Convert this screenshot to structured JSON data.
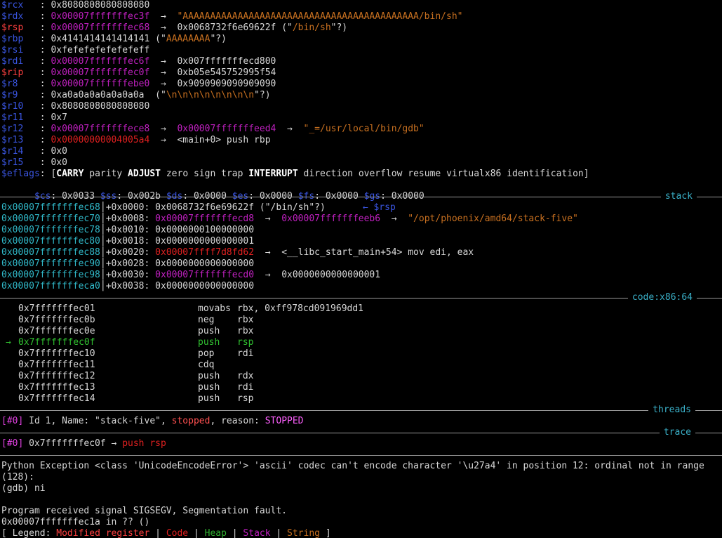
{
  "colors": {
    "register_name": "#3a55e0",
    "modified_register": "#ff4040",
    "stack_address": "#c020c0",
    "code_address": "#e02020",
    "string": "#c87020",
    "stack_slot_address": "#30b8c8",
    "current_instruction": "#30c030",
    "heap": "#30b030"
  },
  "registers": [
    {
      "name": "$rcx",
      "sep": "   : ",
      "value": "0x8080808080808080"
    },
    {
      "name": "$rdx",
      "sep": "   : ",
      "value": "0x00007fffffffec3f",
      "arrow": "  →  ",
      "deref": "\"AAAAAAAAAAAAAAAAAAAAAAAAAAAAAAAAAAAAAAAAAAA/bin/sh\""
    },
    {
      "name": "$rsp",
      "sep": "   : ",
      "value": "0x00007fffffffec68",
      "arrow": "  →  ",
      "deref": "0x0068732f6e69622f",
      "note_open": " (\"",
      "note": "/bin/sh",
      "note_close": "\"?)"
    },
    {
      "name": "$rbp",
      "sep": "   : ",
      "value": "0x4141414141414141",
      "note_open": " (\"",
      "note": "AAAAAAAA",
      "note_close": "\"?)"
    },
    {
      "name": "$rsi",
      "sep": "   : ",
      "value": "0xfefefefefefefeff"
    },
    {
      "name": "$rdi",
      "sep": "   : ",
      "value": "0x00007fffffffec6f",
      "arrow": "  →  ",
      "deref": "0x007fffffffecd800"
    },
    {
      "name": "$rip",
      "sep": "   : ",
      "value": "0x00007fffffffec0f",
      "arrow": "  →  ",
      "deref": "0xb05e545752995f54"
    },
    {
      "name": "$r8",
      "sep": "    : ",
      "value": "0x00007fffffffebe0",
      "arrow": "  →  ",
      "deref": "0x9090909090909090"
    },
    {
      "name": "$r9",
      "sep": "    : ",
      "value": "0xa0a0a0a0a0a0a0a",
      "note_open": "  (\"",
      "note": "\\n\\n\\n\\n\\n\\n\\n\\n",
      "note_close": "\"?)"
    },
    {
      "name": "$r10",
      "sep": "   : ",
      "value": "0x8080808080808080"
    },
    {
      "name": "$r11",
      "sep": "   : ",
      "value": "0x7"
    },
    {
      "name": "$r12",
      "sep": "   : ",
      "value": "0x00007fffffffece8",
      "arrow": "  →  ",
      "deref": "0x00007fffffffeed4",
      "arrow2": "  →  ",
      "deref2": "\"_=/usr/local/bin/gdb\""
    },
    {
      "name": "$r13",
      "sep": "   : ",
      "value": "0x00000000004005a4",
      "arrow": "  →  ",
      "deref": "<main+0> push rbp"
    },
    {
      "name": "$r14",
      "sep": "   : ",
      "value": "0x0"
    },
    {
      "name": "$r15",
      "sep": "   : ",
      "value": "0x0"
    }
  ],
  "eflags": {
    "name": "$eflags",
    "sep": ": ",
    "open": "[",
    "flags": [
      {
        "label": "CARRY",
        "set": true
      },
      {
        "label": "parity",
        "set": false
      },
      {
        "label": "ADJUST",
        "set": true
      },
      {
        "label": "zero",
        "set": false
      },
      {
        "label": "sign",
        "set": false
      },
      {
        "label": "trap",
        "set": false
      },
      {
        "label": "INTERRUPT",
        "set": true
      },
      {
        "label": "direction",
        "set": false
      },
      {
        "label": "overflow",
        "set": false
      },
      {
        "label": "resume",
        "set": false
      },
      {
        "label": "virtualx86",
        "set": false
      },
      {
        "label": "identification",
        "set": false
      }
    ],
    "close": "]"
  },
  "segments": [
    {
      "name": "$cs",
      "value": "0x0033"
    },
    {
      "name": "$ss",
      "value": "0x002b"
    },
    {
      "name": "$ds",
      "value": "0x0000"
    },
    {
      "name": "$es",
      "value": "0x0000"
    },
    {
      "name": "$fs",
      "value": "0x0000"
    },
    {
      "name": "$gs",
      "value": "0x0000"
    }
  ],
  "sections": {
    "stack": "stack",
    "code": "code:x86:64",
    "threads": "threads",
    "trace": "trace"
  },
  "stack": [
    {
      "addr": "0x00007fffffffec68",
      "off": "+0x0000: ",
      "value": "0x0068732f6e69622f",
      "vkind": "plain",
      "note": " (\"/bin/sh\"?)",
      "tag": "← $rsp"
    },
    {
      "addr": "0x00007fffffffec70",
      "off": "+0x0008: ",
      "value": "0x00007fffffffecd8",
      "vkind": "stack",
      "arrow": "  →  ",
      "deref": "0x00007fffffffeeb6",
      "dkind": "stack",
      "arrow2": "  →  ",
      "deref2": "\"/opt/phoenix/amd64/stack-five\""
    },
    {
      "addr": "0x00007fffffffec78",
      "off": "+0x0010: ",
      "value": "0x0000000100000000",
      "vkind": "plain"
    },
    {
      "addr": "0x00007fffffffec80",
      "off": "+0x0018: ",
      "value": "0x0000000000000001",
      "vkind": "plain"
    },
    {
      "addr": "0x00007fffffffec88",
      "off": "+0x0020: ",
      "value": "0x00007ffff7d8fd62",
      "vkind": "code",
      "arrow": "  →  ",
      "deref": "<__libc_start_main+54> mov edi, eax",
      "dkind": "plain"
    },
    {
      "addr": "0x00007fffffffec90",
      "off": "+0x0028: ",
      "value": "0x0000000000000000",
      "vkind": "plain"
    },
    {
      "addr": "0x00007fffffffec98",
      "off": "+0x0030: ",
      "value": "0x00007fffffffecd0",
      "vkind": "stack",
      "arrow": "  →  ",
      "deref": "0x0000000000000001",
      "dkind": "plain"
    },
    {
      "addr": "0x00007fffffffeca0",
      "off": "+0x0038: ",
      "value": "0x0000000000000000",
      "vkind": "plain"
    }
  ],
  "code": [
    {
      "addr": "0x7fffffffec01",
      "mnem": "movabs",
      "ops": "rbx, 0xff978cd091969dd1",
      "current": false
    },
    {
      "addr": "0x7fffffffec0b",
      "mnem": "neg",
      "ops": "rbx",
      "current": false
    },
    {
      "addr": "0x7fffffffec0e",
      "mnem": "push",
      "ops": "rbx",
      "current": false
    },
    {
      "addr": "0x7fffffffec0f",
      "mnem": "push",
      "ops": "rsp",
      "current": true,
      "marker": "→"
    },
    {
      "addr": "0x7fffffffec10",
      "mnem": "pop",
      "ops": "rdi",
      "current": false
    },
    {
      "addr": "0x7fffffffec11",
      "mnem": "cdq",
      "ops": "",
      "current": false
    },
    {
      "addr": "0x7fffffffec12",
      "mnem": "push",
      "ops": "rdx",
      "current": false
    },
    {
      "addr": "0x7fffffffec13",
      "mnem": "push",
      "ops": "rdi",
      "current": false
    },
    {
      "addr": "0x7fffffffec14",
      "mnem": "push",
      "ops": "rsp",
      "current": false
    }
  ],
  "threads": {
    "id_tag": "[#0]",
    "text1": " Id 1, Name: \"stack-five\", ",
    "state": "stopped",
    "text2": ", reason: ",
    "reason": "STOPPED"
  },
  "trace": {
    "id_tag": "[#0]",
    "addr": " 0x7fffffffec0f",
    "arrow": " → ",
    "instr": "push rsp"
  },
  "console": [
    "Python Exception <class 'UnicodeEncodeError'> 'ascii' codec can't encode character '\\u27a4' in position 12: ordinal not in range",
    "(128):",
    "(gdb) ni",
    "",
    "Program received signal SIGSEGV, Segmentation fault.",
    "0x00007fffffffec1a in ?? ()"
  ],
  "legend": {
    "prefix": "[ Legend: ",
    "modified": "Modified register",
    "sep": " | ",
    "code": "Code",
    "heap": "Heap",
    "stack": "Stack",
    "string": "String",
    "suffix": " ]"
  }
}
